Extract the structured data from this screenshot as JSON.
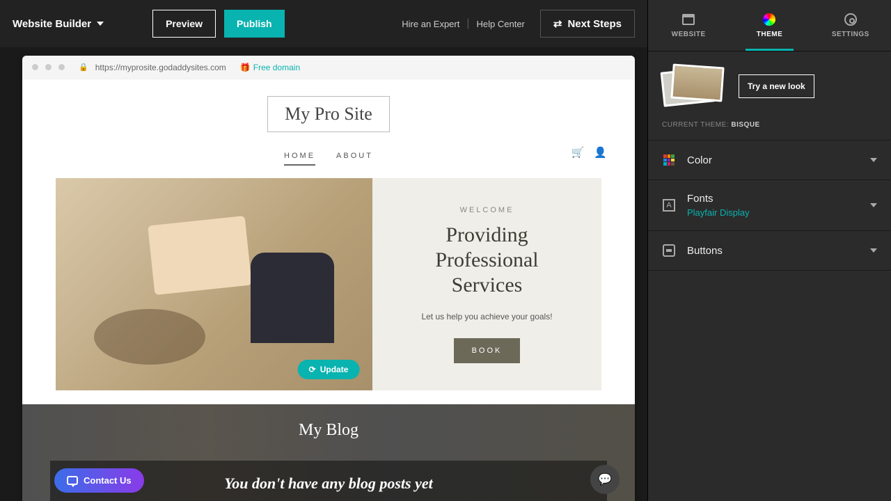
{
  "topbar": {
    "app_name": "Website Builder",
    "preview": "Preview",
    "publish": "Publish",
    "hire_expert": "Hire an Expert",
    "help_center": "Help Center",
    "next_steps": "Next Steps"
  },
  "browser": {
    "url": "https://myprosite.godaddysites.com",
    "free_domain": "Free domain"
  },
  "site": {
    "title": "My Pro Site",
    "nav": {
      "home": "HOME",
      "about": "ABOUT"
    },
    "hero": {
      "eyebrow": "WELCOME",
      "headline_l1": "Providing",
      "headline_l2": "Professional",
      "headline_l3": "Services",
      "sub": "Let us help you achieve your goals!",
      "cta": "BOOK"
    },
    "update_pill": "Update",
    "blog": {
      "title": "My Blog",
      "banner": "You don't have any blog posts yet"
    }
  },
  "panel": {
    "tabs": {
      "website": "WEBSITE",
      "theme": "THEME",
      "settings": "SETTINGS"
    },
    "try_new_look": "Try a new look",
    "current_theme_label": "CURRENT THEME:",
    "current_theme_value": "BISQUE",
    "color": "Color",
    "fonts": "Fonts",
    "fonts_value": "Playfair Display",
    "buttons": "Buttons"
  },
  "contact_us": "Contact Us"
}
